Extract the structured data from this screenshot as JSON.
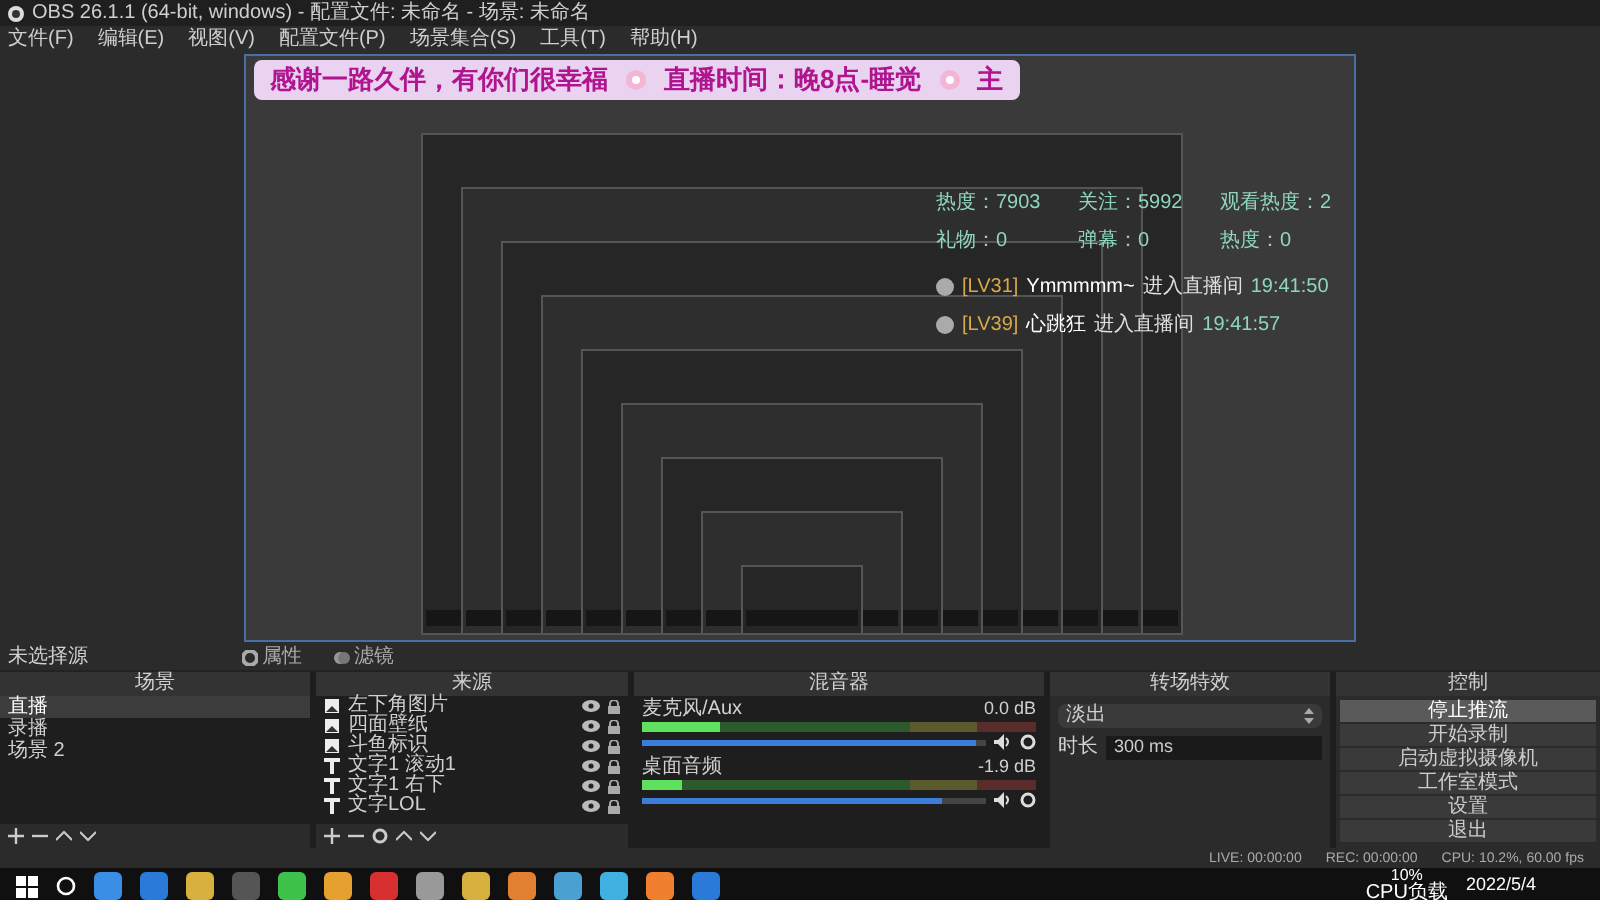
{
  "window": {
    "title": "OBS 26.1.1 (64-bit, windows) - 配置文件: 未命名 - 场景: 未命名"
  },
  "menu": [
    "文件(F)",
    "编辑(E)",
    "视图(V)",
    "配置文件(P)",
    "场景集合(S)",
    "工具(T)",
    "帮助(H)"
  ],
  "preview": {
    "banner": [
      "感谢一路久伴，有你们很幸福",
      "直播时间：晚8点-睡觉",
      "主"
    ],
    "stats": [
      "热度：7903",
      "关注：5992",
      "观看热度：2",
      "礼物：0",
      "弹幕：0",
      "热度：0"
    ],
    "messages": [
      {
        "level": "[LV31]",
        "user": "Ymmmmm~",
        "action": "进入直播间",
        "time": "19:41:50"
      },
      {
        "level": "[LV39]",
        "user": "心跳狂",
        "action": "进入直播间",
        "time": "19:41:57"
      }
    ]
  },
  "source_bar": {
    "label": "未选择源",
    "buttons": [
      "属性",
      "滤镜"
    ]
  },
  "scenes": {
    "title": "场景",
    "items": [
      {
        "name": "直播",
        "selected": true
      },
      {
        "name": "录播",
        "selected": false
      },
      {
        "name": "场景 2",
        "selected": false
      }
    ]
  },
  "sources": {
    "title": "来源",
    "items": [
      {
        "name": "左下角图片",
        "kind": "image"
      },
      {
        "name": "四面壁纸",
        "kind": "image"
      },
      {
        "name": "斗鱼标识",
        "kind": "image"
      },
      {
        "name": "文字1 滚动1",
        "kind": "text"
      },
      {
        "name": "文字1 右下",
        "kind": "text"
      },
      {
        "name": "文字LOL",
        "kind": "text"
      }
    ]
  },
  "mixer": {
    "title": "混音器",
    "channels": [
      {
        "name": "麦克风/Aux",
        "reading": "0.0 dB",
        "meter": {
          "level": 0.2
        },
        "volume": {
          "level": 0.97
        }
      },
      {
        "name": "桌面音频",
        "reading": "-1.9 dB",
        "meter": {
          "level": 0.1
        },
        "volume": {
          "level": 0.87
        }
      }
    ]
  },
  "transitions": {
    "title": "转场特效",
    "value": "淡出",
    "duration_label": "时长",
    "duration": "300 ms"
  },
  "controls": {
    "title": "控制",
    "buttons": [
      {
        "label": "停止推流",
        "on": true
      },
      {
        "label": "开始录制",
        "on": false
      },
      {
        "label": "启动虚拟摄像机",
        "on": false
      },
      {
        "label": "工作室模式",
        "on": false
      },
      {
        "label": "设置",
        "on": false
      },
      {
        "label": "退出",
        "on": false
      }
    ]
  },
  "status_bar": [
    "LIVE: 00:00:00",
    "REC: 00:00:00",
    "CPU: 10.2%, 60.00 fps"
  ],
  "taskbar": {
    "cpu": "10%",
    "cpu_label": "CPU负载",
    "date": "2022/5/4"
  }
}
